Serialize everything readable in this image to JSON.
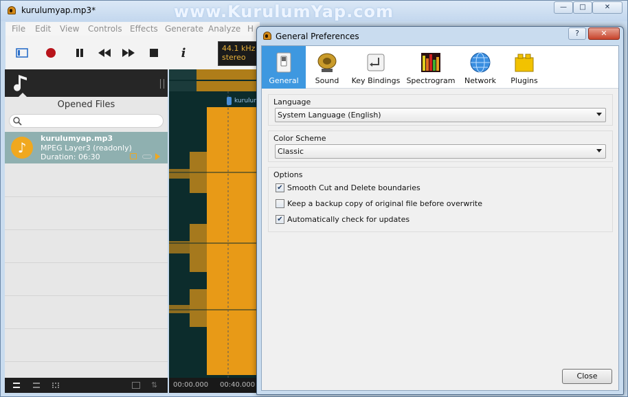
{
  "app": {
    "title": "kurulumyap.mp3*",
    "watermark": "www.KurulumYap.com",
    "window_buttons": {
      "minimize": "—",
      "maximize": "□",
      "close": "✕"
    }
  },
  "menu": [
    "File",
    "Edit",
    "View",
    "Controls",
    "Effects",
    "Generate",
    "Analyze",
    "H"
  ],
  "toolbar": {
    "rate_line1": "44.1 kHz",
    "rate_line2": "stereo",
    "buttons": [
      "sidebar-toggle-icon",
      "record-icon",
      "pause-icon",
      "rewind-icon",
      "fast-forward-icon",
      "stop-icon",
      "info-icon"
    ]
  },
  "sidebar": {
    "title": "Opened Files",
    "search_placeholder": "",
    "file": {
      "name": "kurulumyap.mp3",
      "format": "MPEG Layer3 (readonly)",
      "duration": "Duration: 06:30"
    }
  },
  "waveform": {
    "marker_label": "kurulum",
    "time_start": "00:00.000",
    "time_mid": "00:40.000",
    "colors": {
      "wave": "#e89a17",
      "background": "#0c2c2c",
      "selection": "#f0a820"
    }
  },
  "dialog": {
    "title": "General Preferences",
    "help_button": "?",
    "close_button": "✕",
    "tabs": [
      {
        "label": "General",
        "icon": "switch-icon",
        "active": true
      },
      {
        "label": "Sound",
        "icon": "speaker-icon",
        "active": false
      },
      {
        "label": "Key Bindings",
        "icon": "key-icon",
        "active": false
      },
      {
        "label": "Spectrogram",
        "icon": "spectrogram-icon",
        "active": false
      },
      {
        "label": "Network",
        "icon": "globe-icon",
        "active": false
      },
      {
        "label": "Plugins",
        "icon": "plugin-icon",
        "active": false
      }
    ],
    "language": {
      "label": "Language",
      "value": "System Language (English)"
    },
    "color_scheme": {
      "label": "Color Scheme",
      "value": "Classic"
    },
    "options": {
      "label": "Options",
      "items": [
        {
          "label": "Smooth Cut and Delete boundaries",
          "checked": true,
          "mark": "✔"
        },
        {
          "label": "Keep a backup copy of original file before overwrite",
          "checked": false,
          "mark": ""
        },
        {
          "label": "Automatically check for updates",
          "checked": true,
          "mark": "✔"
        }
      ]
    },
    "close_label": "Close",
    "accent_color": "#3e98e0"
  }
}
